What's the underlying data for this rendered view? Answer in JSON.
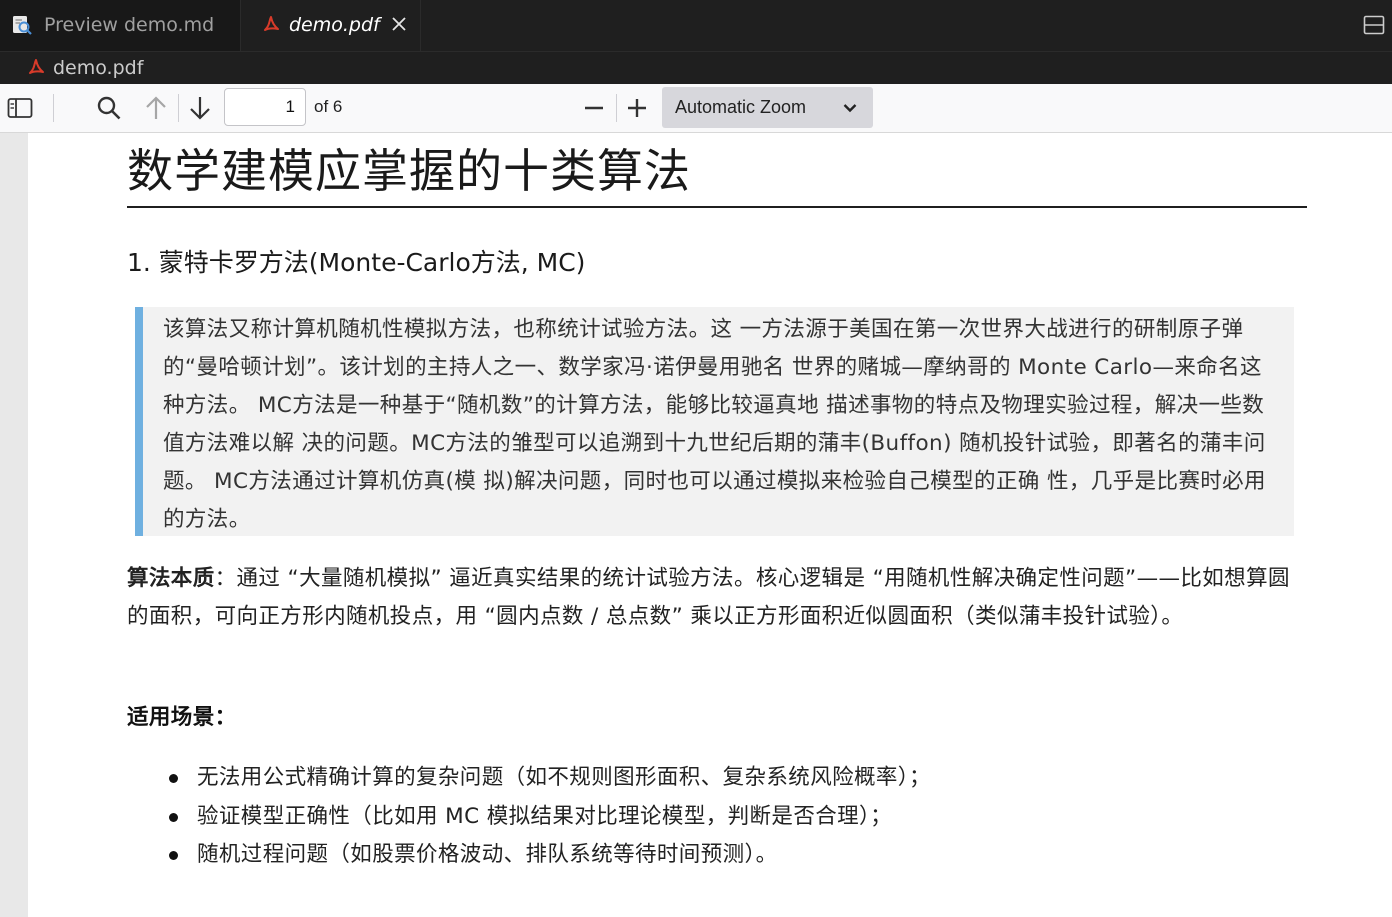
{
  "tabs": [
    {
      "label": "Preview demo.md",
      "icon": "preview-icon",
      "active": false
    },
    {
      "label": "demo.pdf",
      "icon": "pdf-icon",
      "active": true,
      "close_icon": "close-icon"
    }
  ],
  "breadcrumb": {
    "label": "demo.pdf",
    "icon": "pdf-icon"
  },
  "toolbar": {
    "sidebar_toggle_icon": "sidebar-toggle-icon",
    "find_icon": "search-icon",
    "prev_icon": "arrow-up-icon",
    "next_icon": "arrow-down-icon",
    "page_number": "1",
    "page_count": "of 6",
    "zoom_out_icon": "minus-icon",
    "zoom_in_icon": "plus-icon",
    "zoom_value": "Automatic Zoom"
  },
  "document": {
    "title": "数学建模应掌握的十类算法",
    "section_heading": "1. 蒙特卡罗方法(Monte-Carlo方法, MC)",
    "quote": "该算法又称计算机随机性模拟方法，也称统计试验方法。这 一方法源于美国在第一次世界大战进行的研制原子弹的“曼哈顿计划”。该计划的主持人之一、数学家冯·诺伊曼用驰名 世界的赌城—摩纳哥的 Monte Carlo—来命名这种方法。 MC方法是一种基于“随机数”的计算方法，能够比较逼真地 描述事物的特点及物理实验过程，解决一些数值方法难以解 决的问题。MC方法的雏型可以追溯到十九世纪后期的蒲丰(Buffon) 随机投针试验，即著名的蒲丰问题。 MC方法通过计算机仿真(模 拟)解决问题，同时也可以通过模拟来检验自己模型的正确 性，几乎是比赛时必用的方法。",
    "essence_label": "算法本质",
    "essence_text": "：通过 “大量随机模拟” 逼近真实结果的统计试验方法。核心逻辑是 “用随机性解决确定性问题”——比如想算圆的面积，可向正方形内随机投点，用 “圆内点数 / 总点数” 乘以正方形面积近似圆面积（类似蒲丰投针试验）。",
    "scenarios_label": "适用场景：",
    "scenarios": [
      "无法用公式精确计算的复杂问题（如不规则图形面积、复杂系统风险概率）；",
      "验证模型正确性（比如用 MC 模拟结果对比理论模型，判断是否合理）；",
      "随机过程问题（如股票价格波动、排队系统等待时间预测）。"
    ]
  },
  "colors": {
    "tab_bar": "#1f1f1f",
    "pdf_icon": "#d83b2a",
    "quote_border": "#6fb0e0",
    "quote_bg": "#f2f2f2",
    "toolbar_bg": "#f9f9fa",
    "zoom_select_bg": "#d7d7dc"
  }
}
